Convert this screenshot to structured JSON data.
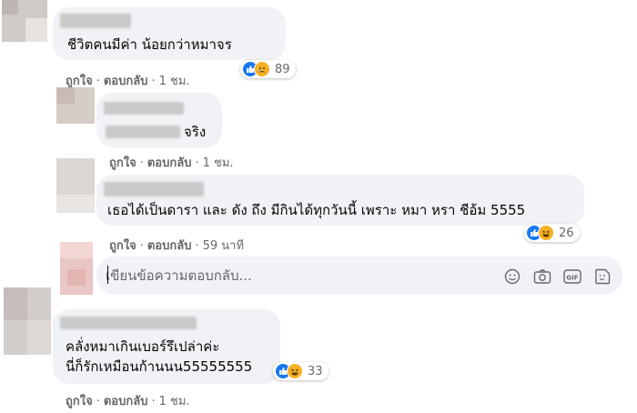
{
  "comments": [
    {
      "text": "ชีวิตคนมีค่า น้อยกว่าหมาจร",
      "actions": {
        "like": "ถูกใจ",
        "reply": "ตอบกลับ",
        "time": "1 ชม."
      },
      "reactions": {
        "count": "89",
        "types": [
          "like-icon",
          "sad-icon"
        ]
      }
    },
    {
      "text": "จริง",
      "actions": {
        "like": "ถูกใจ",
        "reply": "ตอบกลับ",
        "time": "1 ชม."
      }
    },
    {
      "text": "เธอได้เป็นดารา และ ดัง ถึง มีกินได้ทุกวันนี้ เพราะ หมา หรา ชีอ้ม 5555",
      "actions": {
        "like": "ถูกใจ",
        "reply": "ตอบกลับ",
        "time": "59 นาที"
      },
      "reactions": {
        "count": "26",
        "types": [
          "like-icon",
          "haha-icon"
        ]
      }
    },
    {
      "text_line1": "คลั่งหมาเกินเบอร์รึเปล่าค่ะ",
      "text_line2": "นี่ก็รักเหมือนก้านนน55555555",
      "actions": {
        "like": "ถูกใจ",
        "reply": "ตอบกลับ",
        "time": "1 ชม."
      },
      "reactions": {
        "count": "33",
        "types": [
          "like-icon",
          "haha-icon"
        ]
      }
    }
  ],
  "reply_box": {
    "placeholder": "เขียนข้อความตอบกลับ..."
  },
  "icons": [
    "emoji-icon",
    "camera-icon",
    "gif-icon",
    "sticker-icon"
  ],
  "colors": {
    "bubble": "#f0f2f5",
    "like_blue": "#1877f2",
    "muted": "#65676b"
  }
}
